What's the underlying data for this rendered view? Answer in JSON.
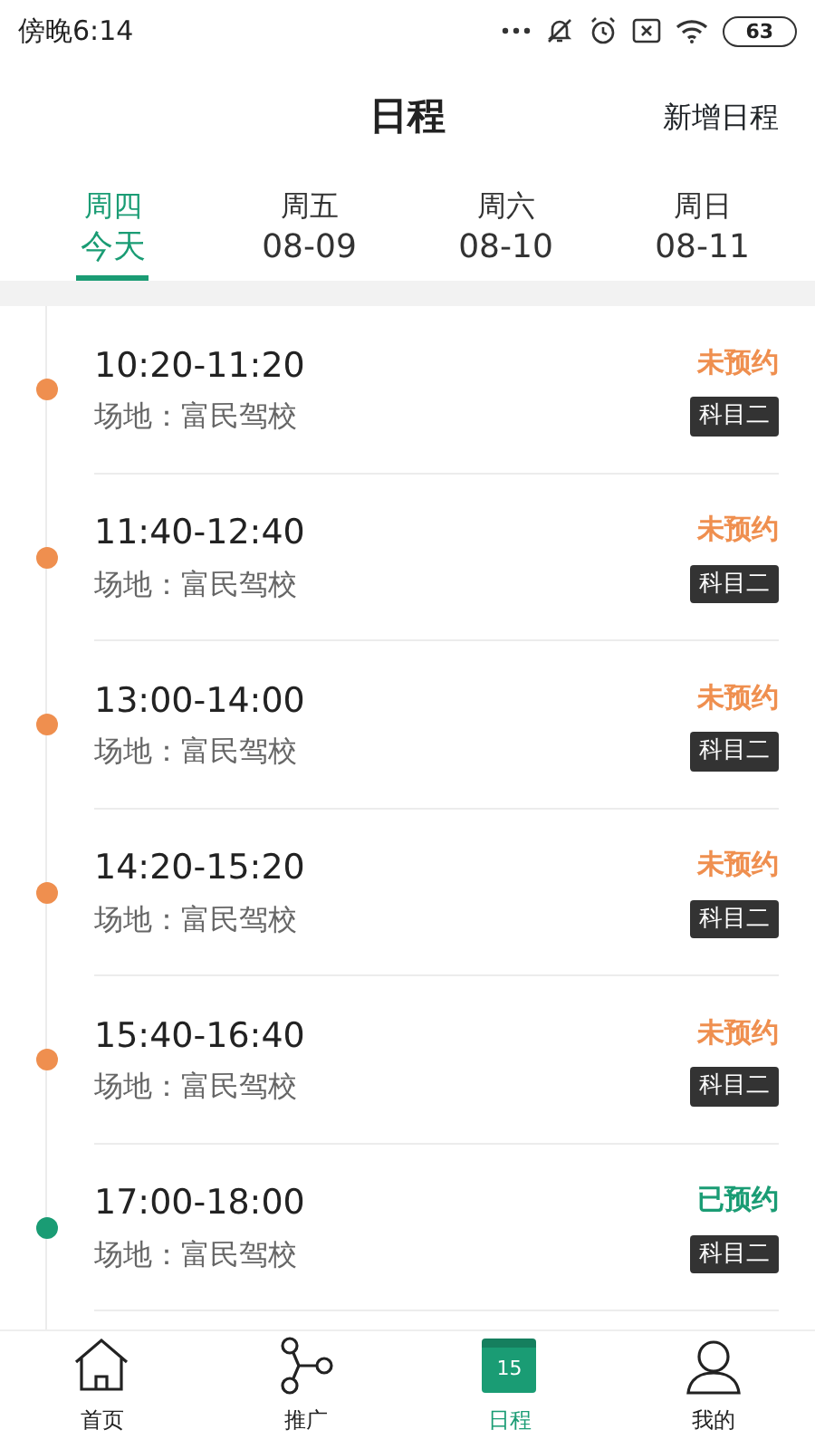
{
  "status_bar": {
    "time": "傍晚6:14",
    "battery": "63"
  },
  "header": {
    "title": "日程",
    "action": "新增日程"
  },
  "tabs": [
    {
      "weekday": "周四",
      "date": "今天",
      "selected": true
    },
    {
      "weekday": "周五",
      "date": "08-09",
      "selected": false
    },
    {
      "weekday": "周六",
      "date": "08-10",
      "selected": false
    },
    {
      "weekday": "周日",
      "date": "08-11",
      "selected": false
    }
  ],
  "slots": [
    {
      "time": "10:20-11:20",
      "venue": "场地：富民驾校",
      "status": "未预约",
      "booked": false,
      "subject": "科目二"
    },
    {
      "time": "11:40-12:40",
      "venue": "场地：富民驾校",
      "status": "未预约",
      "booked": false,
      "subject": "科目二"
    },
    {
      "time": "13:00-14:00",
      "venue": "场地：富民驾校",
      "status": "未预约",
      "booked": false,
      "subject": "科目二"
    },
    {
      "time": "14:20-15:20",
      "venue": "场地：富民驾校",
      "status": "未预约",
      "booked": false,
      "subject": "科目二"
    },
    {
      "time": "15:40-16:40",
      "venue": "场地：富民驾校",
      "status": "未预约",
      "booked": false,
      "subject": "科目二"
    },
    {
      "time": "17:00-18:00",
      "venue": "场地：富民驾校",
      "status": "已预约",
      "booked": true,
      "subject": "科目二"
    }
  ],
  "bottom_nav": [
    {
      "kind": "home",
      "label": "首页",
      "selected": false
    },
    {
      "kind": "share",
      "label": "推广",
      "selected": false
    },
    {
      "kind": "calendar",
      "label": "日程",
      "icon_text": "15",
      "selected": true
    },
    {
      "kind": "profile",
      "label": "我的",
      "selected": false
    }
  ]
}
